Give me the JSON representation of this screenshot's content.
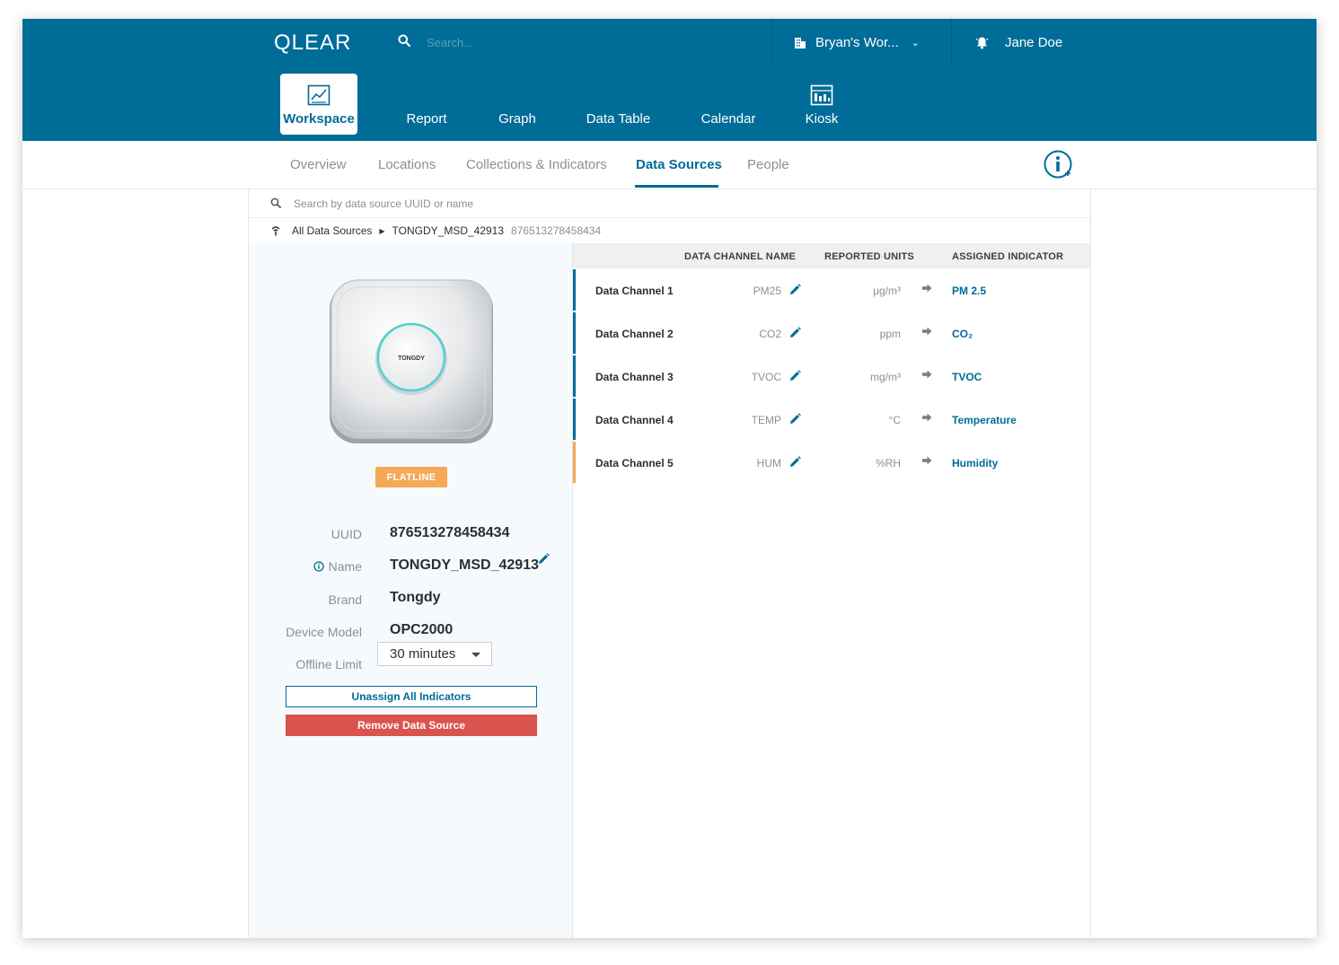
{
  "header": {
    "logo": "QLEAR",
    "search_placeholder": "Search...",
    "workspace_name": "Bryan's Wor...",
    "user_name": "Jane Doe"
  },
  "nav": {
    "tabs": [
      "Workspace",
      "Report",
      "Graph",
      "Data Table",
      "Calendar",
      "Kiosk"
    ],
    "active": "Workspace"
  },
  "subnav": {
    "tabs": [
      "Overview",
      "Locations",
      "Collections & Indicators",
      "Data Sources",
      "People"
    ],
    "active": "Data Sources"
  },
  "data_source_search": {
    "placeholder": "Search by data source UUID or name"
  },
  "breadcrumb": {
    "root": "All Data Sources",
    "current": "TONGDY_MSD_42913",
    "uuid": "876513278458434"
  },
  "device": {
    "brand_on_device": "TONGDY",
    "status": "FLATLINE",
    "status_color": "#f5a855",
    "labels": {
      "uuid": "UUID",
      "name": "Name",
      "brand": "Brand",
      "model": "Device Model",
      "offline": "Offline Limit"
    },
    "uuid": "876513278458434",
    "name": "TONGDY_MSD_42913",
    "brand": "Tongdy",
    "model": "OPC2000",
    "offline_limit": "30 minutes"
  },
  "actions": {
    "unassign": "Unassign All Indicators",
    "remove": "Remove Data Source",
    "remove_color": "#d9534f"
  },
  "table": {
    "headers": [
      "DATA CHANNEL NAME",
      "REPORTED UNITS",
      "ASSIGNED INDICATOR"
    ],
    "rows": [
      {
        "channel": "Data Channel 1",
        "name": "PM25",
        "units": "μg/m³",
        "indicator": "PM 2.5",
        "status": "ok"
      },
      {
        "channel": "Data Channel 2",
        "name": "CO2",
        "units": "ppm",
        "indicator": "CO₂",
        "status": "ok"
      },
      {
        "channel": "Data Channel 3",
        "name": "TVOC",
        "units": "mg/m³",
        "indicator": "TVOC",
        "status": "ok"
      },
      {
        "channel": "Data Channel 4",
        "name": "TEMP",
        "units": "°C",
        "indicator": "Temperature",
        "status": "ok"
      },
      {
        "channel": "Data Channel 5",
        "name": "HUM",
        "units": "%RH",
        "indicator": "Humidity",
        "status": "warning"
      }
    ]
  },
  "colors": {
    "primary": "#006c98",
    "flatline": "#f5a855",
    "danger": "#d9534f"
  }
}
